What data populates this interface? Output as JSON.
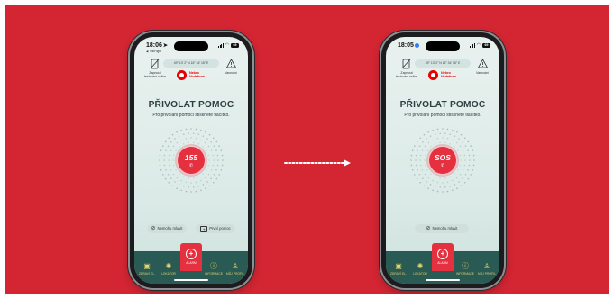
{
  "colors": {
    "background": "#d32532",
    "accent_red": "#e5313f",
    "tabbar": "#2a5a54",
    "tab_text": "#e6d46f",
    "title_text": "#2c4140"
  },
  "before": {
    "status": {
      "time": "18:06",
      "location_icon": "location-arrow-icon",
      "sub_label": "◀ TestFlight",
      "battery": "69"
    },
    "coordinates": "49° 13' 2\" N 16° 34' 18\" E",
    "test_mode_label": "Zapnout testovací režim",
    "warning_label": "Varování",
    "operator": {
      "line1": "Nekro",
      "line2": "Vodafone"
    },
    "title": "PŘIVOLAT POMOC",
    "subtitle": "Pro přivolání pomoci stiskněte tlačítko.",
    "call_button": "155",
    "pills": {
      "nomedic": "Nemohu mluvit",
      "first_aid": "První pomoc"
    }
  },
  "after": {
    "status": {
      "time": "18:05",
      "battery": "69"
    },
    "coordinates": "49° 13' 2\" N 16° 34' 18\" E",
    "test_mode_label": "Zapnout testovací režim",
    "warning_label": "Varování",
    "operator": {
      "line1": "Nekro",
      "line2": "Vodafone"
    },
    "title": "PŘIVOLAT POMOC",
    "subtitle": "Pro přivolání pomoci stiskněte tlačítko.",
    "call_button": "SOS",
    "pills": {
      "nomedic": "Nemohu mluvit"
    }
  },
  "tabs": [
    {
      "label": "ZDRAVÍ EL.",
      "icon": "id-card-icon"
    },
    {
      "label": "LOKÁTOR",
      "icon": "locator-icon"
    },
    {
      "label": "ALARM",
      "icon": "alarm-plus-icon"
    },
    {
      "label": "INFORMACE",
      "icon": "info-icon"
    },
    {
      "label": "MŮJ PROFIL",
      "icon": "profile-icon"
    }
  ]
}
